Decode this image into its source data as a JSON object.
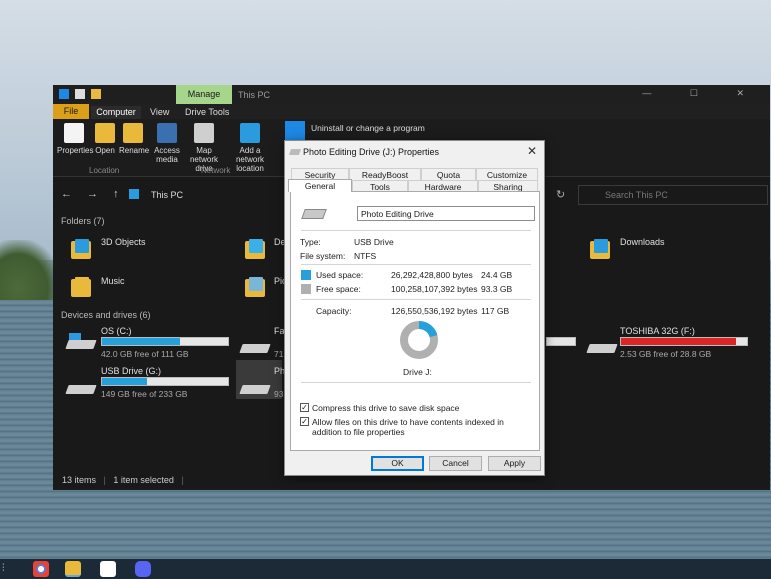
{
  "explorer": {
    "title": "This PC",
    "manage_tab": "Manage",
    "tabs": [
      "File",
      "Computer",
      "View",
      "Drive Tools"
    ],
    "ribbon": {
      "properties": "Properties",
      "open": "Open",
      "rename": "Rename",
      "access_media": "Access media",
      "map_network_drive": "Map network drive",
      "add_network_location": "Add a network location",
      "uninstall": "Uninstall or change a program",
      "group_location": "Location",
      "group_network": "Network"
    },
    "address": {
      "nav_symbols": "← → ↑",
      "path": "This PC",
      "search_placeholder": "Search This PC"
    },
    "folders_header": "Folders (7)",
    "folders": [
      {
        "name": "3D Objects"
      },
      {
        "name": "De"
      },
      {
        "name": "Downloads"
      },
      {
        "name": "Music"
      },
      {
        "name": "Pic"
      }
    ],
    "drives_header": "Devices and drives (6)",
    "drives": [
      {
        "name": "OS (C:)",
        "free": "42.0 GB free of 111 GB",
        "used_fraction": 0.62,
        "color": "#26a0da"
      },
      {
        "name": "Fa",
        "free": "71",
        "used_fraction": 0.0,
        "color": "#26a0da"
      },
      {
        "name": "TOSHIBA 32G (F:)",
        "free": "2.53 GB free of 28.8 GB",
        "used_fraction": 0.91,
        "color": "#da2626"
      },
      {
        "name": "USB Drive (G:)",
        "free": "149 GB free of 233 GB",
        "used_fraction": 0.36,
        "color": "#26a0da"
      },
      {
        "name": "Ph",
        "free": "93",
        "used_fraction": 0.0,
        "color": "#26a0da"
      }
    ],
    "status_items": "13 items",
    "status_selected": "1 item selected"
  },
  "dialog": {
    "title": "Photo Editing Drive (J:) Properties",
    "close": "✕",
    "tabs_row1": [
      "Security",
      "ReadyBoost",
      "Quota",
      "Customize"
    ],
    "tabs_row2": [
      "General",
      "Tools",
      "Hardware",
      "Sharing"
    ],
    "drive_label": "Photo Editing Drive",
    "type_label": "Type:",
    "type_value": "USB Drive",
    "fs_label": "File system:",
    "fs_value": "NTFS",
    "used_label": "Used space:",
    "used_bytes": "26,292,428,800 bytes",
    "used_gb": "24.4 GB",
    "free_label": "Free space:",
    "free_bytes": "100,258,107,392 bytes",
    "free_gb": "93.3 GB",
    "capacity_label": "Capacity:",
    "capacity_bytes": "126,550,536,192 bytes",
    "capacity_gb": "117 GB",
    "used_fraction": 0.208,
    "used_color": "#26a0da",
    "free_color": "#b0b0b0",
    "drive_caption": "Drive J:",
    "compress_label": "Compress this drive to save disk space",
    "index_label": "Allow files on this drive to have contents indexed in addition to file properties",
    "ok": "OK",
    "cancel": "Cancel",
    "apply": "Apply"
  }
}
